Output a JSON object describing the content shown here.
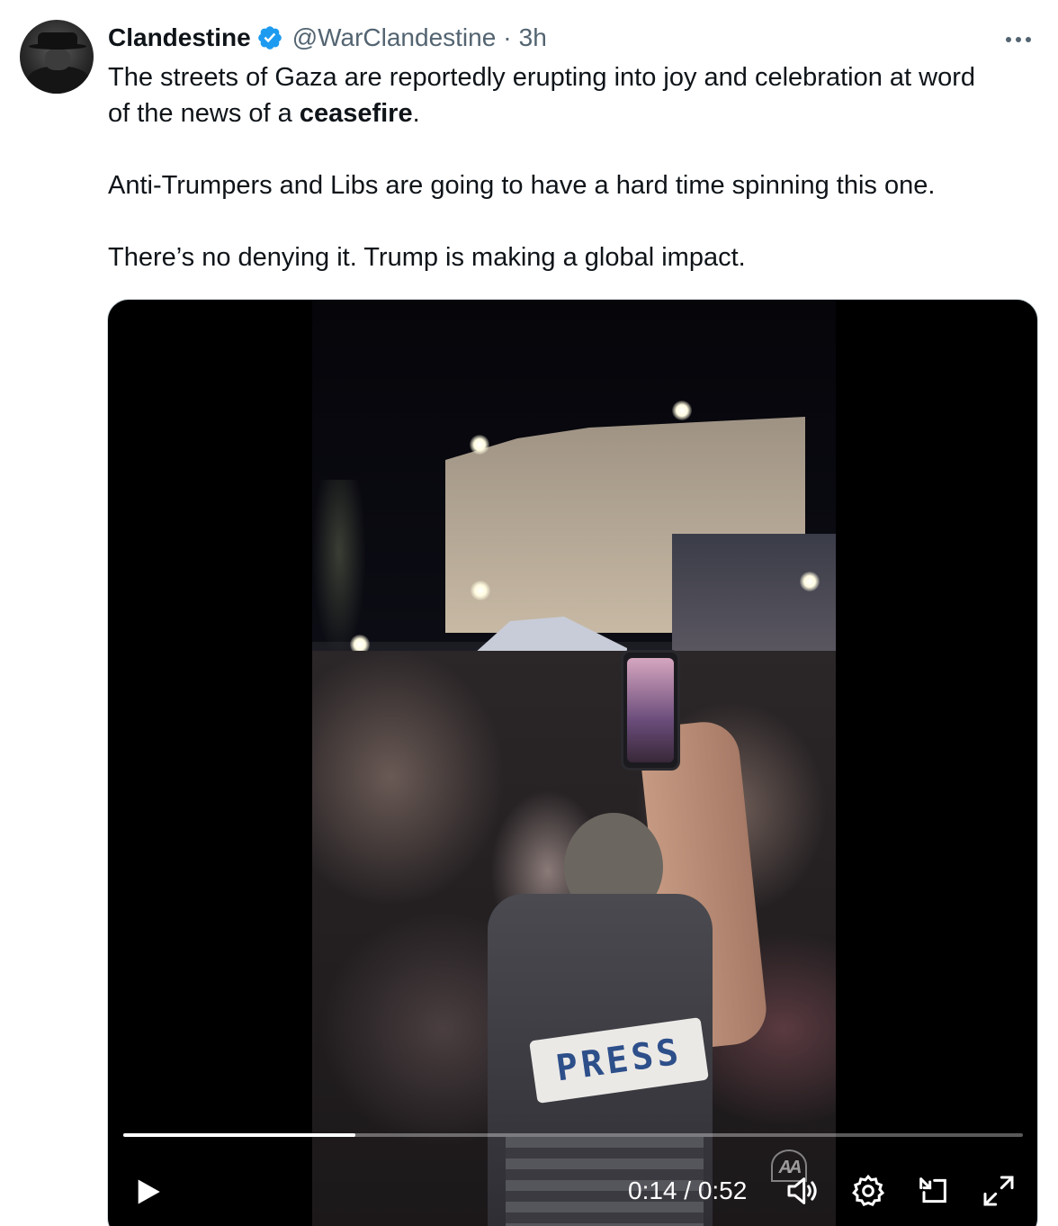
{
  "tweet": {
    "author_name": "Clandestine",
    "handle": "@WarClandestine",
    "separator": "·",
    "time": "3h",
    "verified": true,
    "paragraphs": [
      {
        "before": "The streets of Gaza are reportedly erupting into joy and celebration at word",
        "line2_before": "of the news of a ",
        "bold": "ceasefire",
        "after": "."
      },
      {
        "text": "Anti-Trumpers and Libs are going to have a hard time spinning this one."
      },
      {
        "text": "There’s no denying it. Trump is making a global impact."
      }
    ]
  },
  "video": {
    "current_time": "0:14",
    "duration": "0:52",
    "time_display": "0:14 / 0:52",
    "progress": 0.258,
    "vest_text": "PRESS",
    "watermark": "AA",
    "controls": [
      "play-icon",
      "volume-icon",
      "settings-icon",
      "picture-in-picture-icon",
      "fullscreen-icon"
    ]
  },
  "colors": {
    "text_primary": "#0f1419",
    "text_secondary": "#536471",
    "verified_blue": "#1d9bf0",
    "media_border": "#cfd9de"
  }
}
